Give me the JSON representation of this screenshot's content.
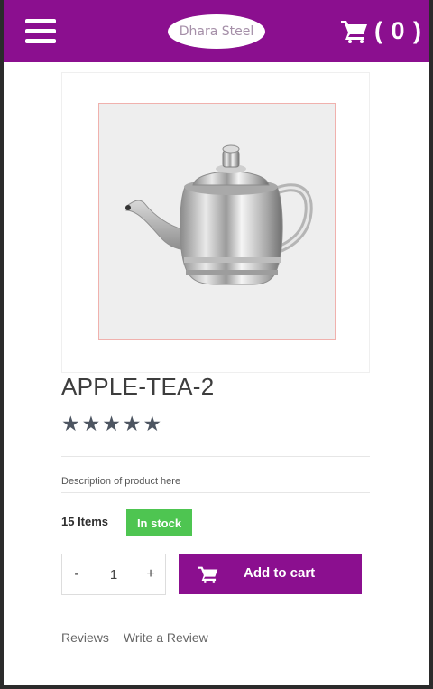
{
  "header": {
    "menu_icon": "hamburger-menu-icon",
    "logo_text": "Dhara Steel",
    "cart_icon": "shopping-cart-icon",
    "cart_count": "( 0 )",
    "background_color": "#8b0f8f"
  },
  "product": {
    "image_alt": "stainless steel tea pot",
    "title": "APPLE-TEA-2",
    "rating": 5,
    "stars": [
      "★",
      "★",
      "★",
      "★",
      "★"
    ],
    "description": "Description of product here",
    "stock_count": "15 Items",
    "stock_status": "In stock",
    "stock_color": "#4ec551"
  },
  "purchase": {
    "minus_label": "-",
    "quantity": "1",
    "plus_label": "+",
    "add_to_cart_label": "Add to cart",
    "add_to_cart_icon": "cart-icon"
  },
  "tabs": [
    "Reviews",
    "Write a Review"
  ]
}
